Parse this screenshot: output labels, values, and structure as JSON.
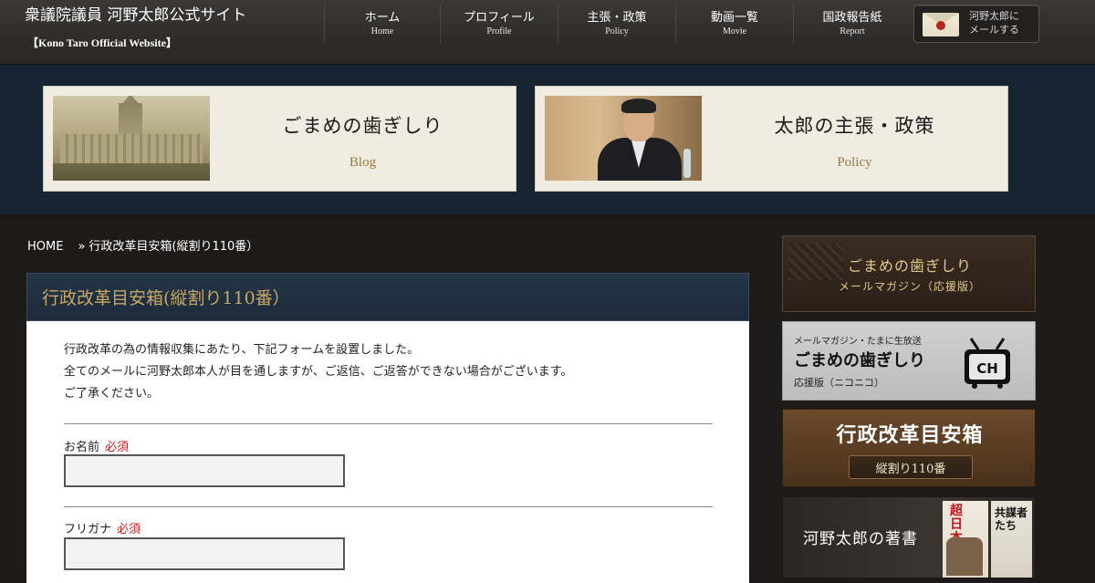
{
  "header": {
    "site_title": "衆議院議員 河野太郎公式サイト",
    "site_subtitle": "【Kono Taro Official Website】",
    "nav": [
      {
        "jp": "ホーム",
        "en": "Home"
      },
      {
        "jp": "プロフィール",
        "en": "Profile"
      },
      {
        "jp": "主張・政策",
        "en": "Policy"
      },
      {
        "jp": "動画一覧",
        "en": "Movie"
      },
      {
        "jp": "国政報告紙",
        "en": "Report"
      }
    ],
    "mail_button": {
      "line1": "河野太郎に",
      "line2": "メールする"
    }
  },
  "banners": [
    {
      "title": "ごまめの歯ぎしり",
      "subtitle": "Blog"
    },
    {
      "title": "太郎の主張・政策",
      "subtitle": "Policy"
    }
  ],
  "breadcrumb": {
    "home": "HOME",
    "separator": "»",
    "current": "行政改革目安箱(縦割り110番）"
  },
  "content": {
    "title": "行政改革目安箱(縦割り110番）",
    "intro": [
      "行政改革の為の情報収集にあたり、下記フォームを設置しました。",
      "全てのメールに河野太郎本人が目を通しますが、ご返信、ご返答ができない場合がございます。",
      "ご了承ください。"
    ],
    "fields": [
      {
        "label": "お名前",
        "required": "必須",
        "value": ""
      },
      {
        "label": "フリガナ",
        "required": "必須",
        "value": ""
      }
    ]
  },
  "sidebar": {
    "mag": {
      "line1": "ごまめの歯ぎしり",
      "line2": "メールマガジン（応援版）"
    },
    "nico": {
      "line1": "メールマガジン・たまに生放送",
      "line2": "ごまめの歯ぎしり",
      "line3": "応援版（ニコニコ）",
      "logo_text": "CH"
    },
    "gyosei": {
      "line1": "行政改革目安箱",
      "line2": "縦割り110番"
    },
    "books": {
      "line1": "河野太郎の著書",
      "book1": "超日本",
      "book2": "共謀者たち"
    }
  },
  "colors": {
    "header_bg": "#2f2d2b",
    "banner_band": "#172533",
    "accent_gold": "#c8a865",
    "required_red": "#d01a1a"
  }
}
